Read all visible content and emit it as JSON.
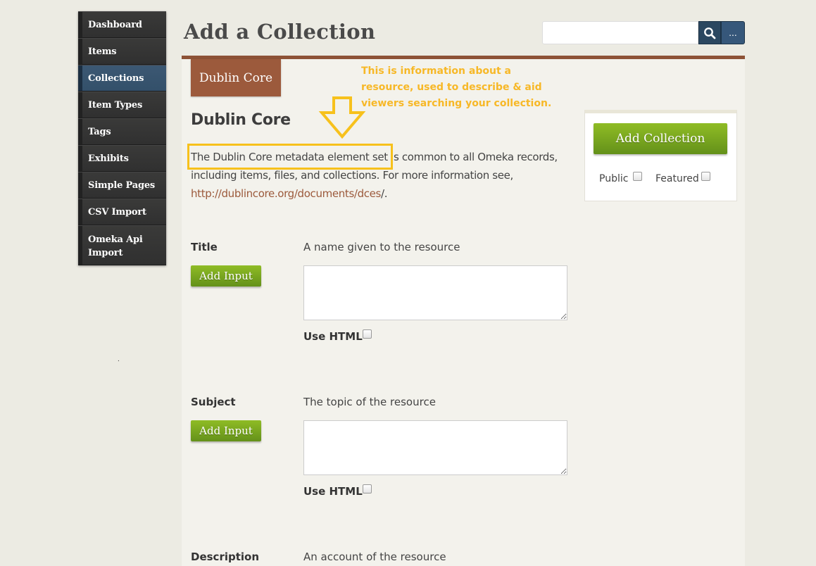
{
  "nav": {
    "items": [
      {
        "label": "Dashboard"
      },
      {
        "label": "Items"
      },
      {
        "label": "Collections"
      },
      {
        "label": "Item Types"
      },
      {
        "label": "Tags"
      },
      {
        "label": "Exhibits"
      },
      {
        "label": "Simple Pages"
      },
      {
        "label": "CSV Import"
      },
      {
        "label": "Omeka Api Import"
      }
    ],
    "active": "Collections",
    "dot": "."
  },
  "header": {
    "title": "Add a Collection",
    "search_value": "",
    "more_label": "..."
  },
  "section_tab": "Dublin Core",
  "annotation": "This is information about a resource, used to describe & aid viewers searching your collection.",
  "section": {
    "heading": "Dublin Core",
    "desc_before": "The Dublin Core metadata element set is common to all Omeka records, including items, files, and collections. For more information see, ",
    "link_text": "http://dublincore.org/documents/dces",
    "desc_after": "/."
  },
  "save_panel": {
    "button": "Add Collection",
    "public_label": "Public",
    "featured_label": "Featured"
  },
  "fields": [
    {
      "label": "Title",
      "help": "A name given to the resource",
      "add_input": "Add Input",
      "use_html": "Use HTML",
      "value": ""
    },
    {
      "label": "Subject",
      "help": "The topic of the resource",
      "add_input": "Add Input",
      "use_html": "Use HTML",
      "value": ""
    },
    {
      "label": "Description",
      "help": "An account of the resource"
    }
  ],
  "colors": {
    "accent_brown": "#9c5a3c",
    "nav_active": "#3c5873",
    "button_green": "#7aa720",
    "annotation_yellow": "#f7b827"
  }
}
